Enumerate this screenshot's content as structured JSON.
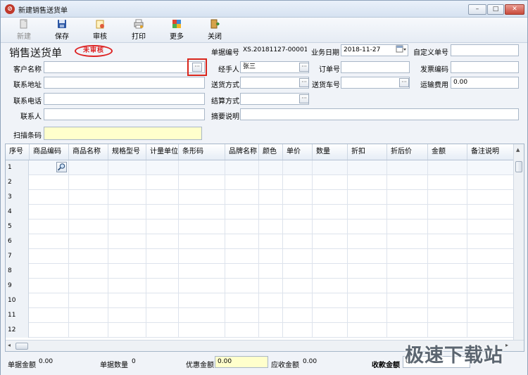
{
  "window": {
    "title": "新建销售送货单",
    "min": "–",
    "max": "□",
    "close": "✕"
  },
  "toolbar": [
    {
      "label": "新建",
      "icon": "new-doc-icon",
      "disabled": true
    },
    {
      "label": "保存",
      "icon": "save-icon",
      "disabled": false
    },
    {
      "label": "审核",
      "icon": "audit-icon",
      "disabled": false
    },
    {
      "label": "打印",
      "icon": "print-icon",
      "disabled": false
    },
    {
      "label": "更多",
      "icon": "more-icon",
      "disabled": false
    },
    {
      "label": "关闭",
      "icon": "close-door-icon",
      "disabled": false
    }
  ],
  "doc": {
    "title": "销售送货单",
    "stamp": "未审核"
  },
  "form": {
    "doc_no_label": "单据编号",
    "doc_no": "XS.20181127-00001",
    "biz_date_label": "业务日期",
    "biz_date": "2018-11-27",
    "custom_no_label": "自定义单号",
    "custom_no": "",
    "customer_label": "客户名称",
    "customer": "",
    "handler_label": "经手人",
    "handler": "张三",
    "order_no_label": "订单号",
    "order_no": "",
    "invoice_label": "发票编码",
    "invoice": "",
    "address_label": "联系地址",
    "address": "",
    "delivery_label": "送货方式",
    "delivery": "",
    "vehicle_label": "送货车号",
    "vehicle": "",
    "freight_label": "运输费用",
    "freight": "0.00",
    "phone_label": "联系电话",
    "phone": "",
    "settle_label": "结算方式",
    "settle": "",
    "contact_label": "联系人",
    "contact": "",
    "summary_label": "摘要说明",
    "summary": "",
    "barcode_label": "扫描条码",
    "barcode": "",
    "ellipsis": "···",
    "dropdown": "▾"
  },
  "grid": {
    "columns": [
      "序号",
      "商品编码",
      "商品名称",
      "规格型号",
      "计量单位",
      "条形码",
      "品牌名称",
      "颜色",
      "单价",
      "数量",
      "折扣",
      "折后价",
      "金额",
      "备注说明"
    ],
    "rows": [
      "1",
      "2",
      "3",
      "4",
      "5",
      "6",
      "7",
      "8",
      "9",
      "10",
      "11",
      "12"
    ]
  },
  "footer": {
    "doc_amount_label": "单据金额",
    "doc_amount": "0.00",
    "doc_qty_label": "单据数量",
    "doc_qty": "0",
    "discount_label": "优惠金额",
    "discount": "0.00",
    "receivable_label": "应收金额",
    "receivable": "0.00",
    "received_label": "收款金额",
    "received": "0.0"
  },
  "watermark": "极速下载站"
}
